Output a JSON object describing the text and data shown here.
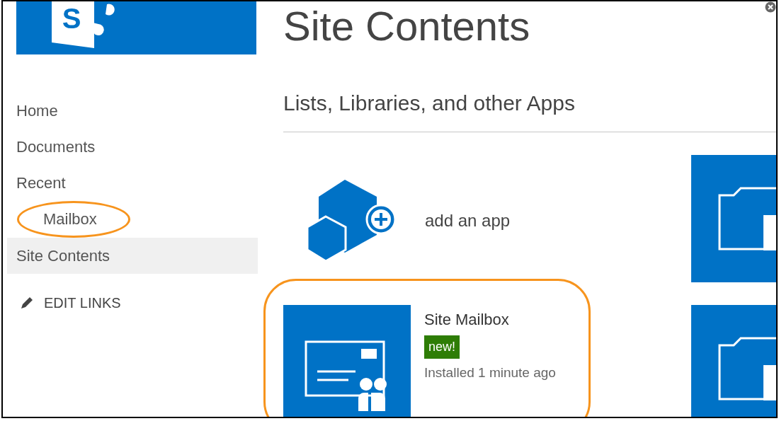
{
  "logo": {
    "letter": "S"
  },
  "page_title": "Site Contents",
  "nav": [
    {
      "label": "Home",
      "selected": false,
      "highlighted": false
    },
    {
      "label": "Documents",
      "selected": false,
      "highlighted": false
    },
    {
      "label": "Recent",
      "selected": false,
      "highlighted": false,
      "children": [
        {
          "label": "Mailbox",
          "selected": false,
          "highlighted": true
        }
      ]
    },
    {
      "label": "Site Contents",
      "selected": true,
      "highlighted": false
    }
  ],
  "edit_links": "EDIT LINKS",
  "section_title": "Lists, Libraries, and other Apps",
  "add_app": {
    "label": "add an app"
  },
  "apps": [
    {
      "name": "Site Mailbox",
      "badge": "new!",
      "status": "Installed 1 minute ago",
      "highlighted": true
    }
  ]
}
